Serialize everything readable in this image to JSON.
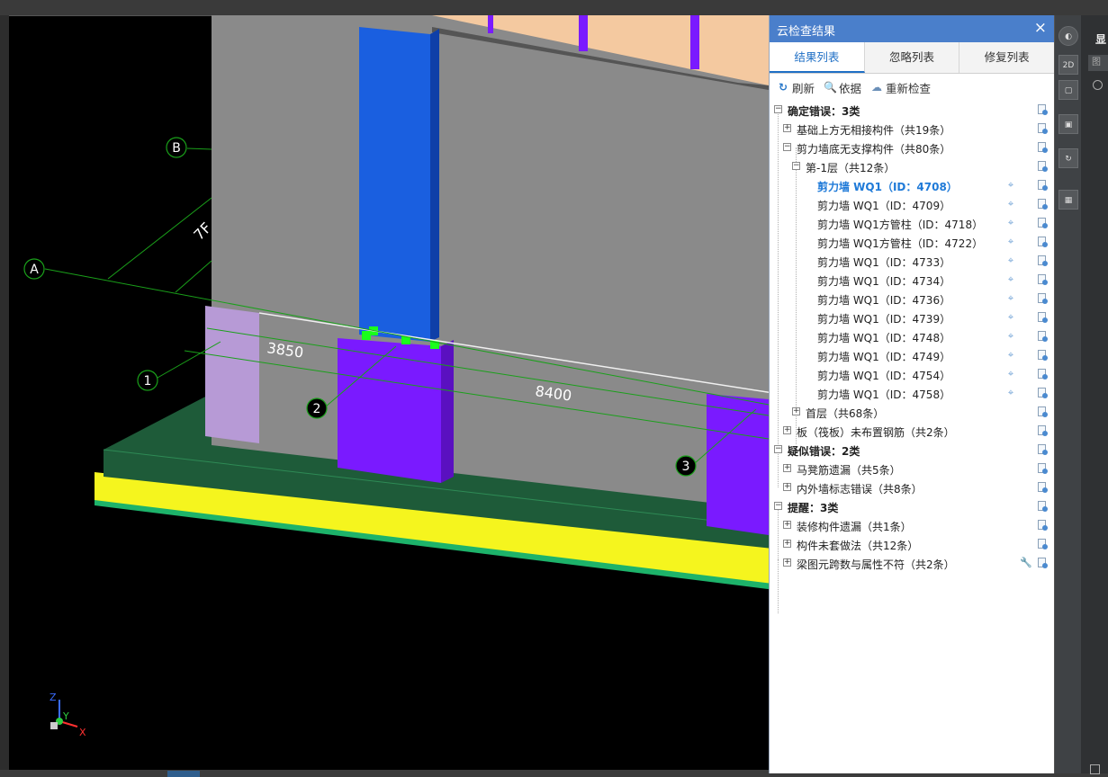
{
  "viewport": {
    "axis_labels": {
      "B": "B",
      "A": "A",
      "n1": "1",
      "n2": "2",
      "n3": "3"
    },
    "dimensions": {
      "d1": "3850",
      "d2": "8400",
      "d3": "7F"
    },
    "gizmo": {
      "z": "Z",
      "y": "Y",
      "x": "X"
    },
    "colors": {
      "wall_gray": "#8a8a8a",
      "column_blue": "#1a5fe0",
      "column_purple": "#7a1aff",
      "lilac": "#b79ad6",
      "slab_green": "#1e5b39",
      "base_yellow": "#f5f51e",
      "marker_green": "#1aff1a"
    }
  },
  "panel": {
    "title": "云检查结果",
    "close": "×",
    "tabs": [
      "结果列表",
      "忽略列表",
      "修复列表"
    ],
    "toolbar": {
      "refresh": "刷新",
      "basis": "依据",
      "recheck": "重新检查"
    },
    "tree": [
      {
        "label": "确定错误：3类",
        "expander": "−",
        "bold": true
      },
      {
        "label": "基础上方无相接构件（共19条）",
        "expander": "+"
      },
      {
        "label": "剪力墙底无支撑构件（共80条）",
        "expander": "−"
      },
      {
        "label": "第-1层（共12条）",
        "expander": "−"
      },
      {
        "label": "剪力墙 WQ1（ID：4708）",
        "selected": true
      },
      {
        "label": "剪力墙 WQ1（ID：4709）"
      },
      {
        "label": "剪力墙 WQ1方管柱（ID：4718）"
      },
      {
        "label": "剪力墙 WQ1方管柱（ID：4722）"
      },
      {
        "label": "剪力墙 WQ1（ID：4733）"
      },
      {
        "label": "剪力墙 WQ1（ID：4734）"
      },
      {
        "label": "剪力墙 WQ1（ID：4736）"
      },
      {
        "label": "剪力墙 WQ1（ID：4739）"
      },
      {
        "label": "剪力墙 WQ1（ID：4748）"
      },
      {
        "label": "剪力墙 WQ1（ID：4749）"
      },
      {
        "label": "剪力墙 WQ1（ID：4754）"
      },
      {
        "label": "剪力墙 WQ1（ID：4758）"
      },
      {
        "label": "首层（共68条）",
        "expander": "+"
      },
      {
        "label": "板（筏板）未布置钢筋（共2条）",
        "expander": "+"
      },
      {
        "label": "疑似错误：2类",
        "expander": "−",
        "bold": true
      },
      {
        "label": "马凳筋遗漏（共5条）",
        "expander": "+"
      },
      {
        "label": "内外墙标志错误（共8条）",
        "expander": "+"
      },
      {
        "label": "提醒：3类",
        "expander": "−",
        "bold": true
      },
      {
        "label": "装修构件遗漏（共1条）",
        "expander": "+"
      },
      {
        "label": "构件未套做法（共12条）",
        "expander": "+"
      },
      {
        "label": "梁图元跨数与属性不符（共2条）",
        "expander": "+"
      }
    ]
  },
  "right_tools": {
    "btn_2d": "2D",
    "side_label": "显",
    "side_field": "图"
  }
}
